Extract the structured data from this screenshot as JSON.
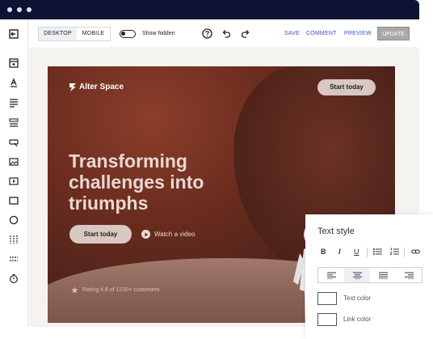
{
  "toolbar": {
    "desktop_label": "DESKTOP",
    "mobile_label": "MOBILE",
    "show_hidden_label": "Show hidden",
    "save_label": "SAVE",
    "comment_label": "COMMENT",
    "preview_label": "PREVIEW",
    "update_label": "UPDATE"
  },
  "hero": {
    "brand": "Alter Space",
    "top_button": "Start today",
    "headline": "Transforming challenges into triumphs",
    "cta_button": "Start today",
    "video_link": "Watch a video",
    "rating_text": "Rating 4.8 of 1230+ customers"
  },
  "text_style_panel": {
    "title": "Text style",
    "text_color_label": "Text color",
    "link_color_label": "Link color"
  },
  "colors": {
    "titlebar": "#0d1433",
    "accent_link": "#3c4fd1",
    "update_button": "#a9a9a9",
    "hero_background": "#6a2c1f",
    "hero_button": "#d9c8c2"
  }
}
